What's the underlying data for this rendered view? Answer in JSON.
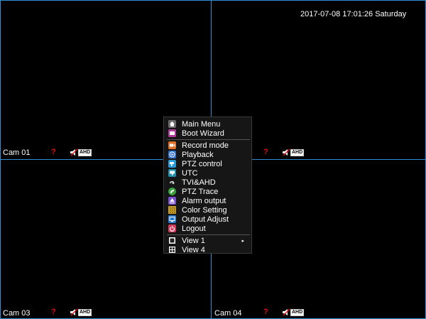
{
  "datetime": "2017-07-08 17:01:26  Saturday",
  "cameras": [
    {
      "label": "Cam 01",
      "status_icon": "?",
      "badge": "AHD"
    },
    {
      "label": "",
      "status_icon": "?",
      "badge": "AHD"
    },
    {
      "label": "Cam 03",
      "status_icon": "?",
      "badge": "AHD"
    },
    {
      "label": "Cam 04",
      "status_icon": "?",
      "badge": "AHD"
    }
  ],
  "menu": {
    "items": [
      {
        "label": "Main Menu",
        "icon": "home-icon",
        "color": "#6b6b6b"
      },
      {
        "label": "Boot Wizard",
        "icon": "wizard-icon",
        "color": "#b03a9a"
      },
      {
        "label": "Record mode",
        "icon": "record-icon",
        "color": "#e0702a"
      },
      {
        "label": "Playback",
        "icon": "playback-icon",
        "color": "#2f6fd0"
      },
      {
        "label": "PTZ control",
        "icon": "ptz-icon",
        "color": "#2a9ad8"
      },
      {
        "label": "UTC",
        "icon": "utc-icon",
        "color": "#1f8fb0"
      },
      {
        "label": "TVI&AHD",
        "icon": "tvi-ahd-icon",
        "color": "#222222"
      },
      {
        "label": "PTZ Trace",
        "icon": "ptz-trace-icon",
        "color": "#3aa040"
      },
      {
        "label": "Alarm output",
        "icon": "alarm-icon",
        "color": "#7a4fd0"
      },
      {
        "label": "Color Setting",
        "icon": "color-icon",
        "color": "#c8a028"
      },
      {
        "label": "Output Adjust",
        "icon": "output-icon",
        "color": "#2a7ad0"
      },
      {
        "label": "Logout",
        "icon": "logout-icon",
        "color": "#d23a5a"
      },
      {
        "label": "View 1",
        "icon": "view1-icon",
        "color": "#444444"
      },
      {
        "label": "View 4",
        "icon": "view4-icon",
        "color": "#444444"
      }
    ],
    "submenu_arrow": "▸"
  }
}
